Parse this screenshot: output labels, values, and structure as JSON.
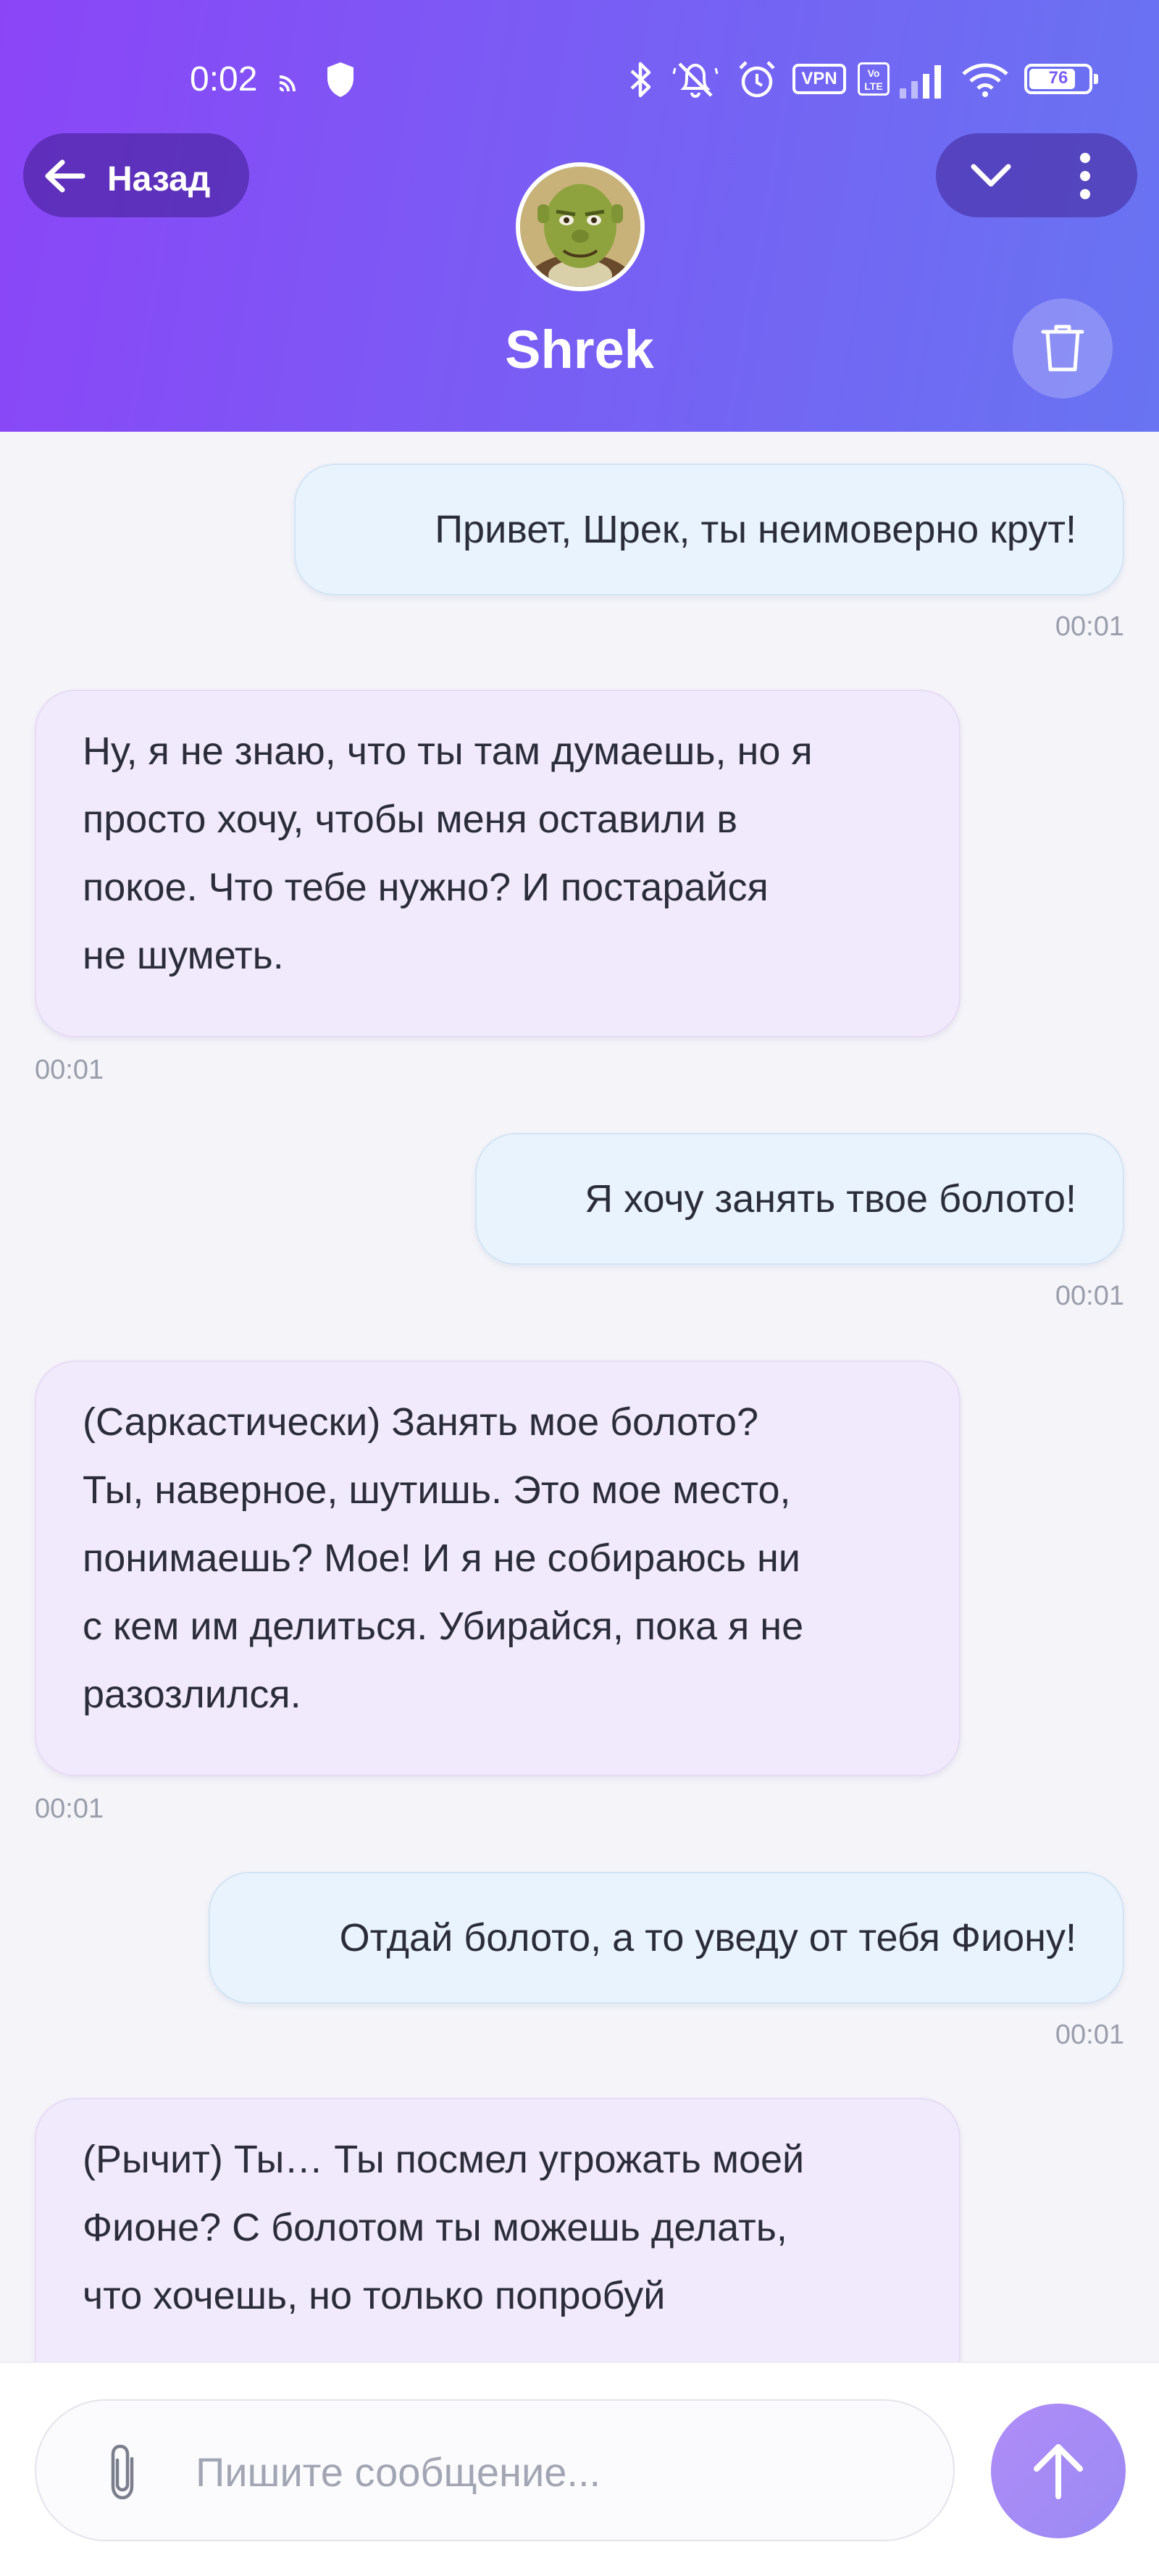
{
  "status_bar": {
    "time": "0:02",
    "battery": "76",
    "icons": [
      "cast-icon",
      "shield-icon",
      "bluetooth-icon",
      "mute-icon",
      "alarm-icon",
      "vpn-badge",
      "volte-badge",
      "signal-icon",
      "wifi-icon",
      "battery-icon"
    ],
    "vpn_label": "VPN",
    "volte_label": "Vo LTE"
  },
  "header": {
    "back_label": "Назад",
    "character_name": "Shrek",
    "icons": {
      "back": "arrow-left-icon",
      "collapse": "chevron-down-icon",
      "more": "more-vertical-icon",
      "delete": "trash-icon"
    }
  },
  "messages": [
    {
      "role": "user",
      "text": "Привет, Шрек, ты неимоверно крут!",
      "time": "00:01"
    },
    {
      "role": "bot",
      "lines": [
        "Ну, я не знаю, что ты там думаешь, но я",
        "просто хочу, чтобы меня оставили в",
        "покое. Что тебе нужно? И постарайся",
        "не шуметь."
      ],
      "time": "00:01"
    },
    {
      "role": "user",
      "text": "Я хочу занять твое болото!",
      "time": "00:01"
    },
    {
      "role": "bot",
      "lines": [
        "(Саркастически) Занять мое болото?",
        "Ты, наверное, шутишь. Это мое место,",
        "понимаешь? Мое! И я не собираюсь ни",
        "с кем им делиться. Убирайся, пока я не",
        "разозлился."
      ],
      "time": "00:01"
    },
    {
      "role": "user",
      "text": "Отдай болото, а то уведу от тебя Фиону!",
      "time": "00:01"
    },
    {
      "role": "bot",
      "lines": [
        "(Рычит) Ты… Ты посмел угрожать моей",
        "Фионе? С болотом ты можешь делать,",
        "что хочешь, но только попробуй"
      ],
      "time": ""
    }
  ],
  "composer": {
    "placeholder": "Пишите сообщение...",
    "value": "",
    "icons": {
      "attach": "paperclip-icon",
      "send": "arrow-up-icon"
    }
  },
  "colors": {
    "header_start": "#8b45f7",
    "header_end": "#6874f2",
    "user_bubble": "#e9f3fd",
    "bot_bubble": "#f1e9fc",
    "send_button": "#a98bf6",
    "background": "#f4f4f9"
  }
}
